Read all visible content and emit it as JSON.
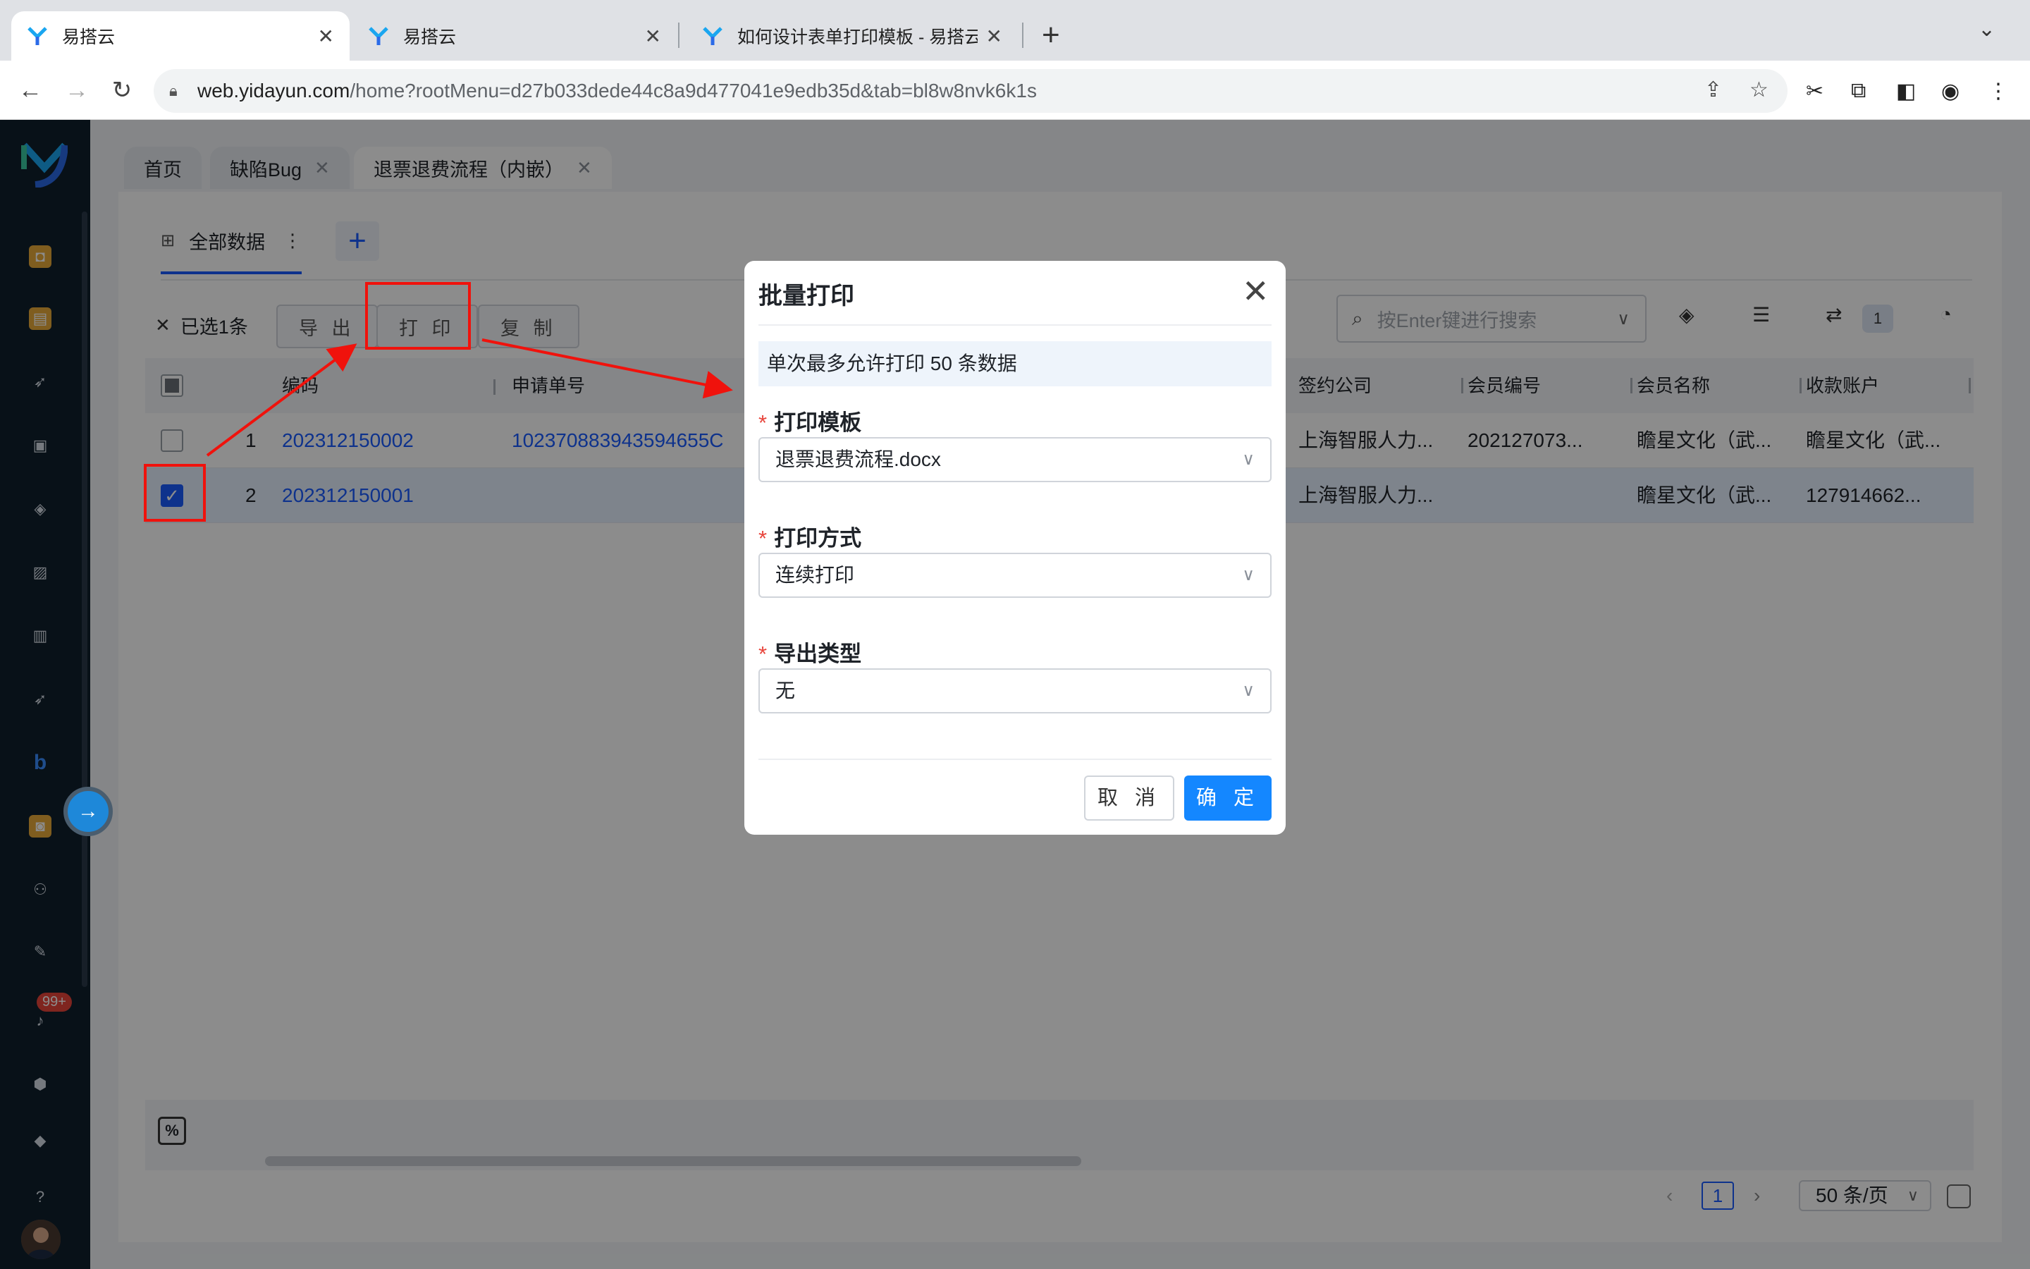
{
  "browser": {
    "tabs": [
      {
        "title": "易搭云",
        "active": true
      },
      {
        "title": "易搭云",
        "active": false
      },
      {
        "title": "如何设计表单打印模板 - 易搭云",
        "active": false
      }
    ],
    "url_host": "web.yidayun.com",
    "url_path": "/home?rootMenu=d27b033dede44c8a9d477041e9edb35d&tab=bl8w8nvk6k1s"
  },
  "rail": {
    "notification_badge": "99+"
  },
  "page_tabs": [
    {
      "label": "首页",
      "closable": false
    },
    {
      "label": "缺陷Bug",
      "closable": true
    },
    {
      "label": "退票退费流程（内嵌）",
      "closable": true
    }
  ],
  "view": {
    "active_view": "全部数据",
    "selected_text": "已选1条",
    "actions": {
      "export": "导 出",
      "print": "打 印",
      "copy": "复 制"
    },
    "search_placeholder": "按Enter键进行搜索",
    "filter_count": "1"
  },
  "table": {
    "columns": [
      "编码",
      "申请单号",
      "签约公司",
      "会员编号",
      "会员名称",
      "收款账户"
    ],
    "rows": [
      {
        "index": "1",
        "code": "202312150002",
        "apply_no": "102370883943594655C",
        "company": "上海智服人力...",
        "member_no": "202127073...",
        "member_name": "瞻星文化（武...",
        "account": "瞻星文化（武...",
        "checked": false
      },
      {
        "index": "2",
        "code": "202312150001",
        "apply_no": "",
        "company": "上海智服人力...",
        "member_no": "",
        "member_name": "瞻星文化（武...",
        "account": "127914662...",
        "checked": true
      }
    ]
  },
  "pagination": {
    "current": "1",
    "page_size": "50 条/页"
  },
  "modal": {
    "title": "批量打印",
    "notice": "单次最多允许打印 50 条数据",
    "fields": [
      {
        "label": "打印模板",
        "value": "退票退费流程.docx"
      },
      {
        "label": "打印方式",
        "value": "连续打印"
      },
      {
        "label": "导出类型",
        "value": "无"
      }
    ],
    "cancel": "取 消",
    "ok": "确 定"
  },
  "colors": {
    "accent": "#1487ff",
    "link": "#1b5cff",
    "annotation": "#f0120c",
    "rail": "#0f1f2d"
  }
}
